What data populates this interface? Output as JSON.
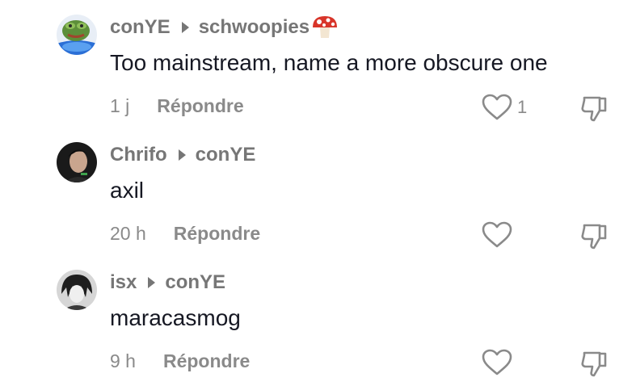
{
  "comments": [
    {
      "author": "conYE",
      "reply_to": "schwoopies",
      "reply_to_emoji": "mushroom-icon",
      "text": "Too mainstream, name a more obscure one",
      "time": "1 j",
      "reply_label": "Répondre",
      "like_count": "1"
    },
    {
      "author": "Chrifo",
      "reply_to": "conYE",
      "text": "axil",
      "time": "20 h",
      "reply_label": "Répondre",
      "like_count": ""
    },
    {
      "author": "isx",
      "reply_to": "conYE",
      "text": "maracasmog",
      "time": "9 h",
      "reply_label": "Répondre",
      "like_count": ""
    }
  ],
  "colors": {
    "muted_text": "#8a8a8a",
    "primary_text": "#161823",
    "background": "#ffffff"
  }
}
